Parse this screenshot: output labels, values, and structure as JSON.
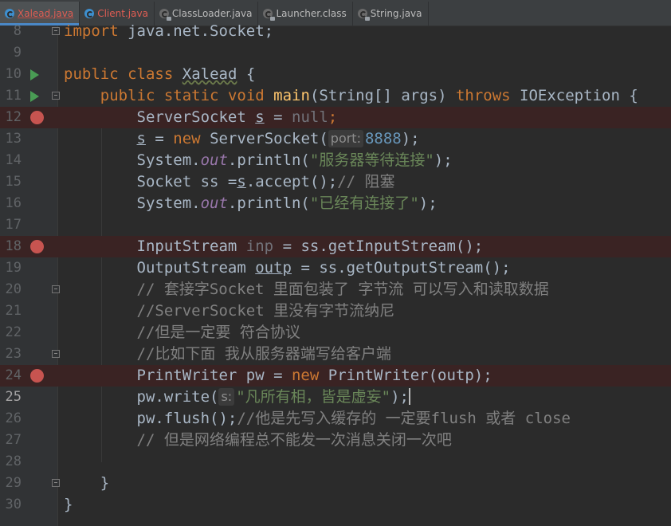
{
  "tabs": [
    {
      "label": "Xalead.java",
      "icon": "java-class-icon",
      "active": true
    },
    {
      "label": "Client.java",
      "icon": "java-class-icon",
      "active": false
    },
    {
      "label": "ClassLoader.java",
      "icon": "library-class-icon",
      "active": false
    },
    {
      "label": "Launcher.class",
      "icon": "library-class-icon",
      "active": false
    },
    {
      "label": "String.java",
      "icon": "library-class-icon",
      "active": false
    }
  ],
  "lines": [
    {
      "n": "8"
    },
    {
      "n": "9"
    },
    {
      "n": "10"
    },
    {
      "n": "11"
    },
    {
      "n": "12"
    },
    {
      "n": "13"
    },
    {
      "n": "14"
    },
    {
      "n": "15"
    },
    {
      "n": "16"
    },
    {
      "n": "17"
    },
    {
      "n": "18"
    },
    {
      "n": "19"
    },
    {
      "n": "20"
    },
    {
      "n": "21"
    },
    {
      "n": "22"
    },
    {
      "n": "23"
    },
    {
      "n": "24"
    },
    {
      "n": "25"
    },
    {
      "n": "26"
    },
    {
      "n": "27"
    },
    {
      "n": "28"
    },
    {
      "n": "29"
    },
    {
      "n": "30"
    }
  ],
  "code": {
    "l8": {
      "kw": "import",
      "rest": " java.net.Socket;"
    },
    "l10": {
      "kw1": "public",
      "kw2": "class",
      "name": "Xalead",
      "brace": " {"
    },
    "l11": {
      "kw1": "public",
      "kw2": "static",
      "kw3": "void",
      "fn": "main",
      "params": "(String[] args) ",
      "kw4": "throws",
      "exc": " IOException {"
    },
    "l12": {
      "type": "ServerSocket ",
      "var": "s",
      "eq": " = ",
      "val": "null",
      "semi": ";"
    },
    "l13": {
      "var": "s",
      "eq": " = ",
      "kw": "new",
      "call": " ServerSocket(",
      "hint": "port:",
      "num": "8888",
      "end": ");"
    },
    "l14": {
      "pre": "System.",
      "fld": "out",
      "call": ".println(",
      "str": "\"服务器等待连接\"",
      "end": ");"
    },
    "l15": {
      "pre": "Socket ss =",
      "var": "s",
      "call": ".accept();",
      "cmt": "// 阻塞"
    },
    "l16": {
      "pre": "System.",
      "fld": "out",
      "call": ".println(",
      "str": "\"已经有连接了\"",
      "end": ");"
    },
    "l18": {
      "type": "InputStream ",
      "var": "inp",
      "rest": " = ss.getInputStream();"
    },
    "l19": {
      "type": "OutputStream ",
      "var": "outp",
      "rest": " = ss.getOutputStream();"
    },
    "l20": {
      "cmt": "// 套接字Socket 里面包装了 字节流 可以写入和读取数据"
    },
    "l21": {
      "cmt": "//ServerSocket 里没有字节流纳尼"
    },
    "l22": {
      "cmt": "//但是一定要 符合协议"
    },
    "l23": {
      "cmt": "//比如下面 我从服务器端写给客户端"
    },
    "l24": {
      "pre": "PrintWriter pw = ",
      "kw": "new",
      "rest": " PrintWriter(outp);"
    },
    "l25": {
      "pre": "pw.write(",
      "hint": "s:",
      "str": "\"凡所有相，皆是虚妄\"",
      "end": ");"
    },
    "l26": {
      "pre": "pw.flush();",
      "cmt": "//他是先写入缓存的 一定要flush 或者 close"
    },
    "l27": {
      "cmt": "// 但是网络编程总不能发一次消息关闭一次吧"
    },
    "l29": {
      "brace": "}"
    },
    "l30": {
      "brace": "}"
    }
  },
  "colors": {
    "background": "#2b2b2b",
    "gutter": "#313335",
    "keyword": "#cc7832",
    "string": "#6a8759",
    "number": "#6897bb",
    "comment": "#808080",
    "breakpoint": "#c75450",
    "run": "#499c54"
  }
}
